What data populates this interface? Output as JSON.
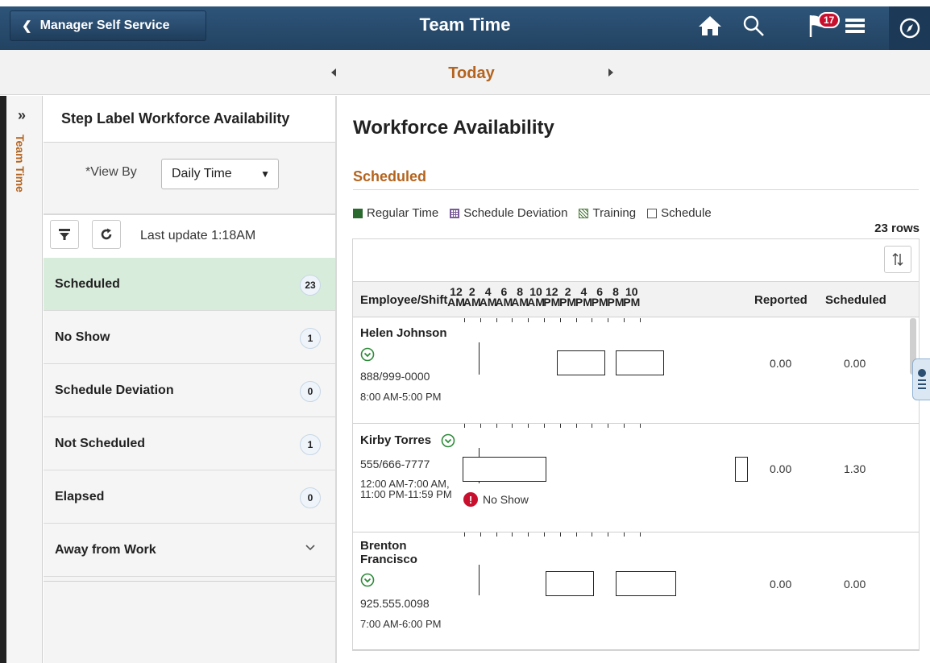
{
  "header": {
    "back_label": "Manager Self Service",
    "title": "Team Time",
    "notification_count": "17",
    "icons": [
      "home-icon",
      "search-icon",
      "notification-flag-icon",
      "menu-icon",
      "navbar-compass-icon"
    ]
  },
  "datebar": {
    "label": "Today"
  },
  "rail": {
    "label": "Team Time"
  },
  "left_panel": {
    "title": "Step Label Workforce Availability",
    "view_by_label": "*View By",
    "view_by_value": "Daily Time",
    "last_update": "Last update 1:18AM",
    "categories": [
      {
        "label": "Scheduled",
        "count": "23",
        "selected": true
      },
      {
        "label": "No Show",
        "count": "1"
      },
      {
        "label": "Schedule Deviation",
        "count": "0"
      },
      {
        "label": "Not Scheduled",
        "count": "1"
      },
      {
        "label": "Elapsed",
        "count": "0"
      },
      {
        "label": "Away from Work",
        "count": ""
      }
    ]
  },
  "main": {
    "title": "Workforce Availability",
    "section_title": "Scheduled",
    "legend": [
      {
        "label": "Regular Time",
        "color": "#2b6a2e"
      },
      {
        "label": "Schedule Deviation",
        "color": "#7a5a9a"
      },
      {
        "label": "Training",
        "color": "#4a7a3a"
      },
      {
        "label": "Schedule",
        "color": "#ffffff"
      }
    ],
    "rows_count": "23 rows",
    "columns": {
      "employee": "Employee/Shift",
      "reported": "Reported",
      "scheduled": "Scheduled"
    },
    "hours": [
      {
        "n": "12",
        "p": "AM"
      },
      {
        "n": "2",
        "p": "AM"
      },
      {
        "n": "4",
        "p": "AM"
      },
      {
        "n": "6",
        "p": "AM"
      },
      {
        "n": "8",
        "p": "AM"
      },
      {
        "n": "10",
        "p": "AM"
      },
      {
        "n": "12",
        "p": "PM"
      },
      {
        "n": "2",
        "p": "PM"
      },
      {
        "n": "4",
        "p": "PM"
      },
      {
        "n": "6",
        "p": "PM"
      },
      {
        "n": "8",
        "p": "PM"
      },
      {
        "n": "10",
        "p": "PM"
      }
    ],
    "employees": [
      {
        "name": "Helen Johnson",
        "phone": "888/999-0000",
        "shift": "8:00 AM-5:00 PM",
        "reported": "0.00",
        "scheduled": "0.00",
        "status": ""
      },
      {
        "name": "Kirby Torres",
        "phone": "555/666-7777",
        "shift": "12:00 AM-7:00 AM, 11:00 PM-11:59 PM",
        "reported": "0.00",
        "scheduled": "1.30",
        "status": "No Show"
      },
      {
        "name": "Brenton Francisco",
        "phone": "925.555.0098",
        "shift": "7:00 AM-6:00 PM",
        "reported": "0.00",
        "scheduled": "0.00",
        "status": ""
      }
    ]
  }
}
